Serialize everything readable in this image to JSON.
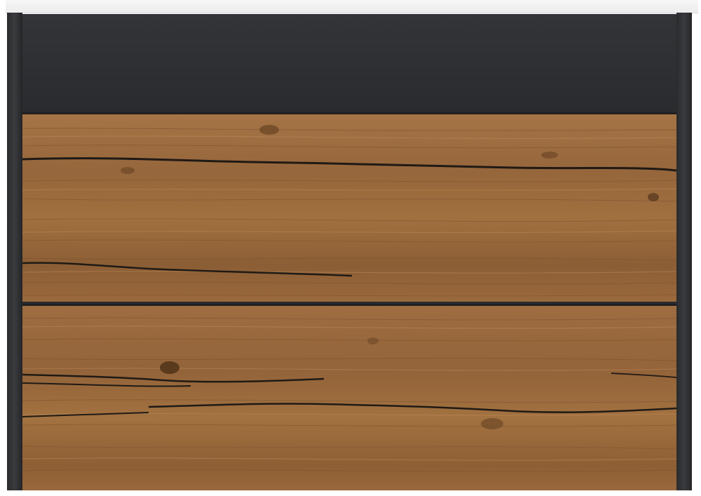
{
  "scene": {
    "subject": "vanity-cabinet-front",
    "colors": {
      "frame": "#2c2d30",
      "top_panel": "#303134",
      "wood_base": "#9a6a40",
      "wood_dark": "#6e4827",
      "wood_light": "#b68554",
      "crack": "#1f1a15",
      "countertop": "#f2f2f2"
    },
    "drawers": [
      {
        "name": "upper-drawer",
        "material": "oak-wood"
      },
      {
        "name": "lower-drawer",
        "material": "oak-wood"
      }
    ]
  }
}
